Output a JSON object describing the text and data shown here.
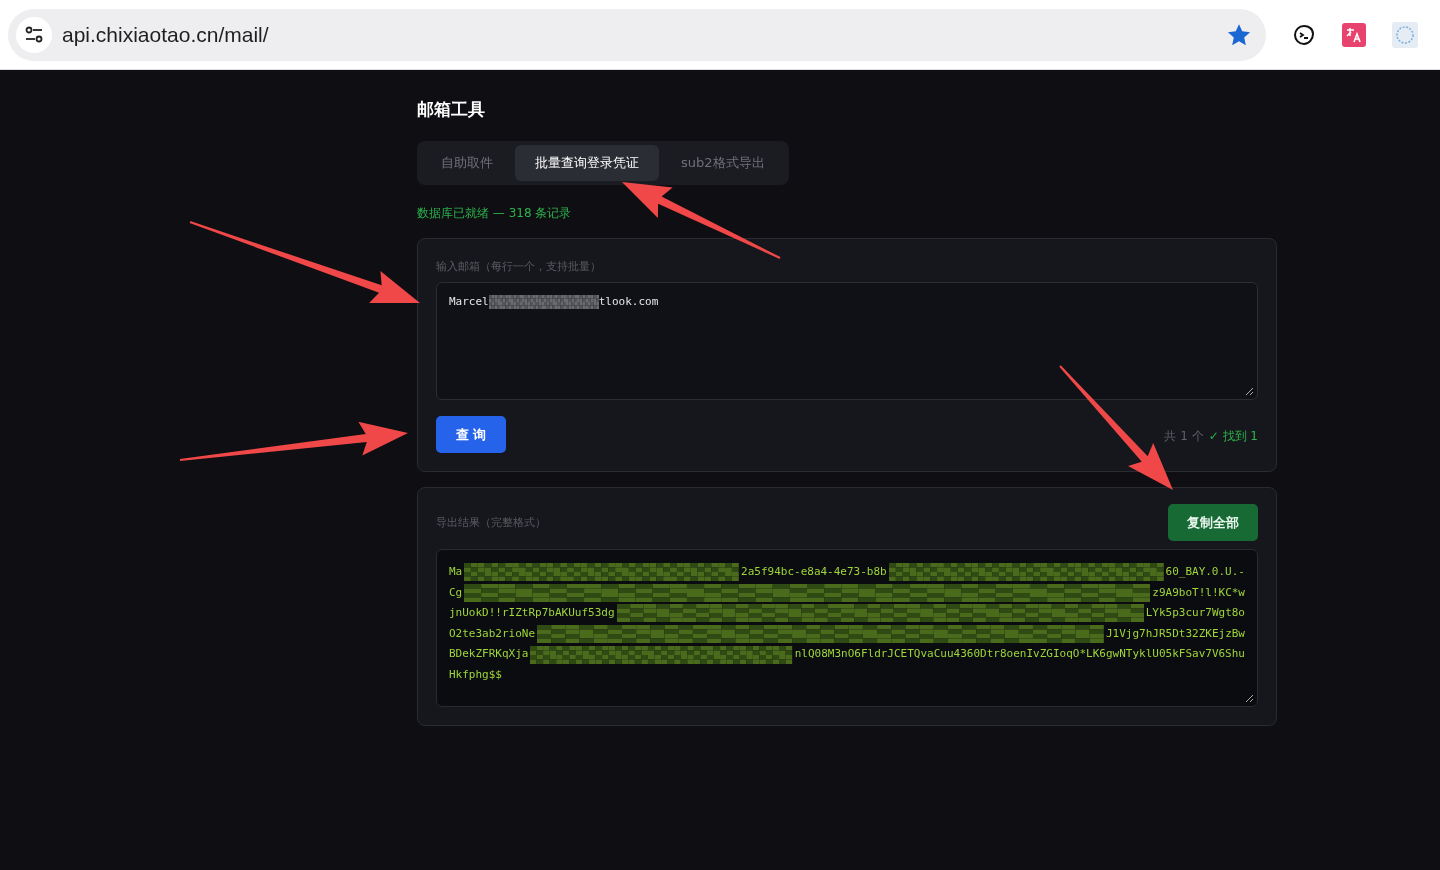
{
  "browser": {
    "url": "api.chixiaotao.cn/mail/",
    "bookmarked": true
  },
  "title": "邮箱工具",
  "tabs": [
    {
      "label": "自助取件",
      "selected": false
    },
    {
      "label": "批量查询登录凭证",
      "selected": true
    },
    {
      "label": "sub2格式导出",
      "selected": false
    }
  ],
  "status": "数据库已就绪 — 318 条记录",
  "query_card": {
    "label": "输入邮箱（每行一个，支持批量）",
    "input_parts": [
      "Marcel",
      "tlook.com"
    ],
    "button": "查 询",
    "total": "共 1 个",
    "found": "✓ 找到 1"
  },
  "export_card": {
    "label": "导出结果（完整格式）",
    "button": "复制全部",
    "lines": [
      [
        "Ma",
        "2a5f94bc-e8a4-4e73-b8b",
        "60_BAY.0.U.-"
      ],
      [
        "Cg",
        "z9A9boT!l!KC*w"
      ],
      [
        "jnUokD!!rIZtRp7bAKUuf53dg",
        "LYk5p3cur7Wgt8o"
      ],
      [
        "O2te3ab2rioNe",
        "J1Vjg7hJR5Dt32ZKEjzBw"
      ],
      [
        "BDekZFRKqXja",
        "nlQ08M3nO6FldrJCETQvaCuu4360Dtr8oenIvZGIoqO*LK6gwNTyklU05kFSav7V6Shu"
      ],
      [
        "Hkfphg$$"
      ]
    ]
  }
}
